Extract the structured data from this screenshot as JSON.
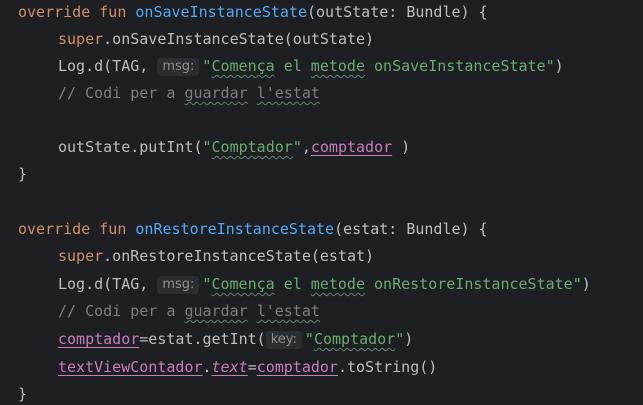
{
  "code": {
    "l1": {
      "kw1": "override",
      "kw2": "fun",
      "fn": "onSaveInstanceState",
      "rest": "(outState: Bundle) {"
    },
    "l2": {
      "kw": "super",
      "rest": ".onSaveInstanceState(outState)"
    },
    "l3": {
      "pre": "Log.d(TAG, ",
      "hint": "msg:",
      "s1": "\"",
      "w1": "Comença",
      "s2": " el ",
      "w2": "metode",
      "s3": " onSaveInstanceState\"",
      "post": ")"
    },
    "l4": {
      "c1": "// Codi per a ",
      "w1": "guardar",
      "c2": " ",
      "w2": "l'estat"
    },
    "l6": {
      "pre": "outState.putInt(",
      "s1": "\"",
      "w1": "Comptador",
      "s2": "\"",
      "comma": ",",
      "prop": "comptador",
      "post": " )"
    },
    "l7": {
      "brace": "}"
    },
    "l9": {
      "kw1": "override",
      "kw2": "fun",
      "fn": "onRestoreInstanceState",
      "rest": "(estat: Bundle) {"
    },
    "l10": {
      "kw": "super",
      "rest": ".onRestoreInstanceState(estat)"
    },
    "l11": {
      "pre": "Log.d(TAG, ",
      "hint": "msg:",
      "s1": "\"",
      "w1": "Comença",
      "s2": " el ",
      "w2": "metode",
      "s3": " onRestoreInstanceState\"",
      "post": ")"
    },
    "l12": {
      "c1": "// Codi per a ",
      "w1": "guardar",
      "c2": " ",
      "w2": "l'estat"
    },
    "l13": {
      "prop": "comptador",
      "mid": "=estat.getInt(",
      "hint": "key:",
      "s1": "\"",
      "w1": "Comptador",
      "s2": "\"",
      "post": ")"
    },
    "l14": {
      "p1": "textViewContador",
      "dot": ".",
      "p2": "text",
      "eq": "=",
      "p3": "comptador",
      "post": ".toString()"
    },
    "l15": {
      "brace": "}"
    }
  }
}
